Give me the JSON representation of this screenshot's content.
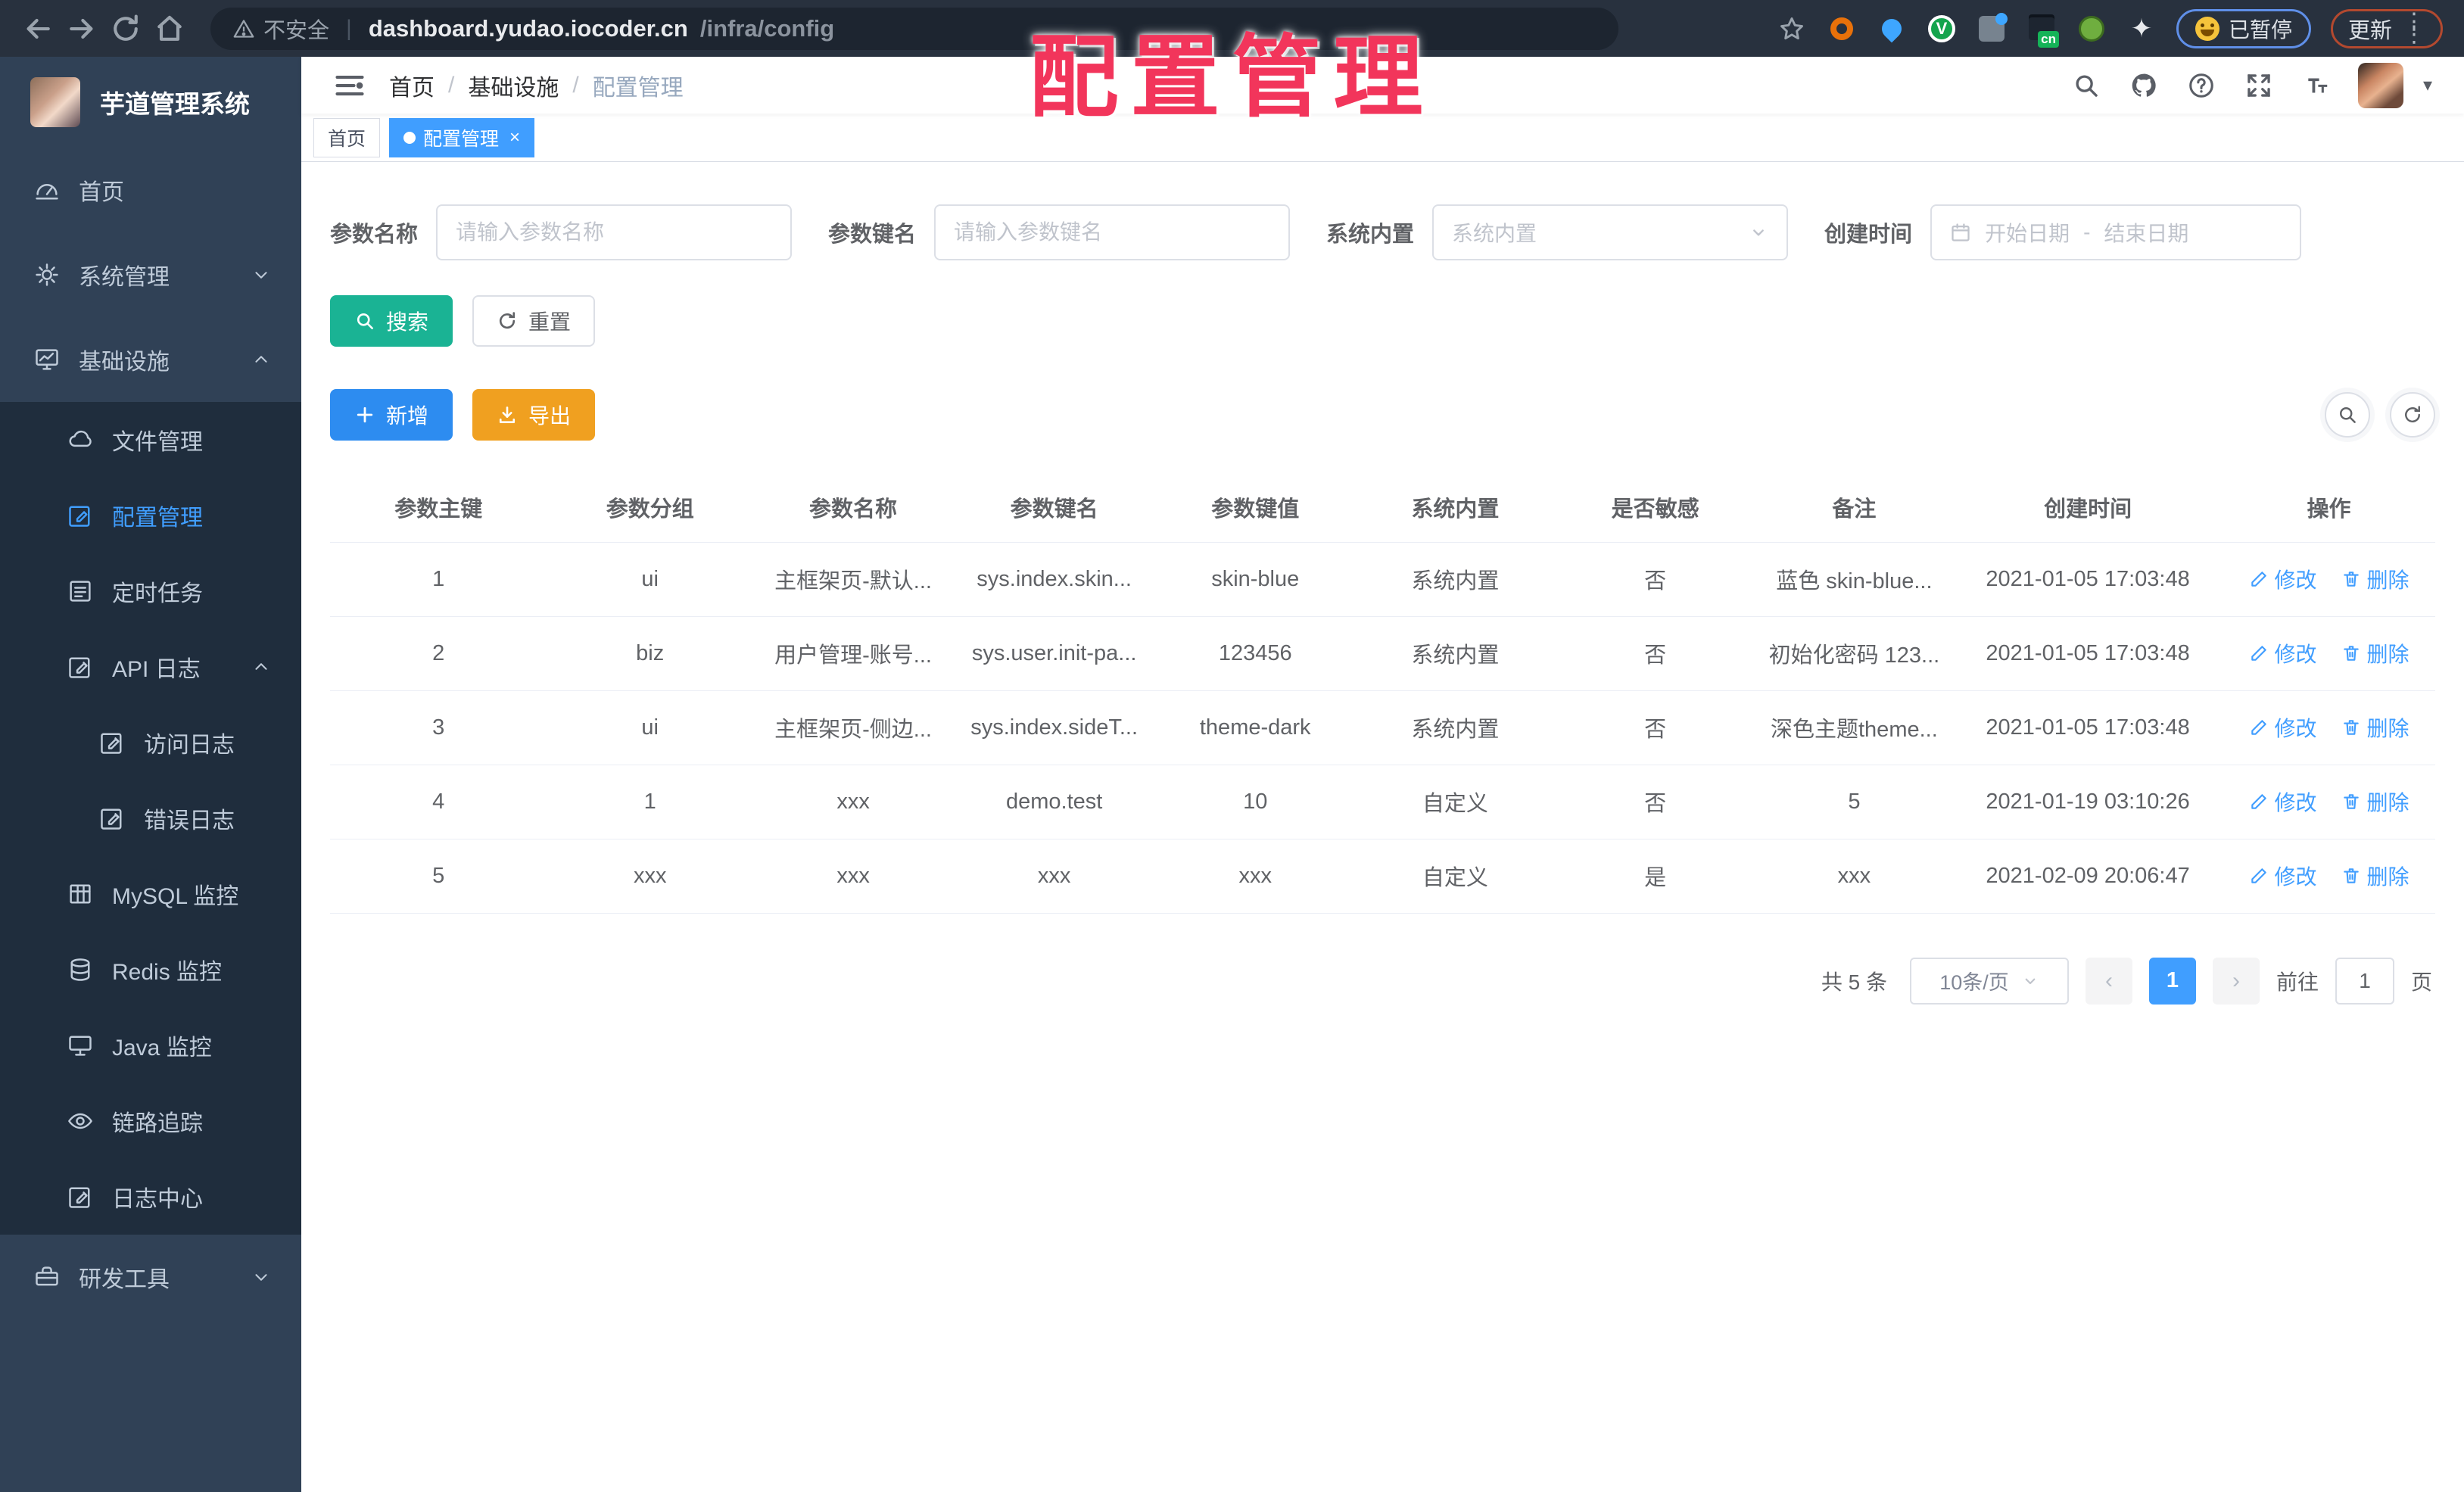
{
  "annotation": {
    "text": "配置管理"
  },
  "browser": {
    "security_label": "不安全",
    "url_host": "dashboard.yudao.iocoder.cn",
    "url_path": "/infra/config",
    "paused_label": "已暂停",
    "update_label": "更新"
  },
  "sidebar": {
    "title": "芋道管理系统",
    "items": [
      {
        "key": "home",
        "label": "首页",
        "icon": "dashboard-icon",
        "level": 1
      },
      {
        "key": "system-management",
        "label": "系统管理",
        "icon": "gear-icon",
        "level": 1,
        "chevron": "down"
      },
      {
        "key": "infrastructure",
        "label": "基础设施",
        "icon": "infra-icon",
        "level": 1,
        "chevron": "up"
      },
      {
        "key": "file-management",
        "label": "文件管理",
        "icon": "cloud-icon",
        "level": 2
      },
      {
        "key": "config-management",
        "label": "配置管理",
        "icon": "edit-square-icon",
        "level": 2,
        "active": true
      },
      {
        "key": "scheduled-tasks",
        "label": "定时任务",
        "icon": "task-icon",
        "level": 2
      },
      {
        "key": "api-logs",
        "label": "API 日志",
        "icon": "log-icon",
        "level": 2,
        "chevron": "up"
      },
      {
        "key": "access-logs",
        "label": "访问日志",
        "icon": "log-icon",
        "level": 3
      },
      {
        "key": "error-logs",
        "label": "错误日志",
        "icon": "log-icon",
        "level": 3
      },
      {
        "key": "mysql-monitor",
        "label": "MySQL 监控",
        "icon": "table-grid-icon",
        "level": 2
      },
      {
        "key": "redis-monitor",
        "label": "Redis 监控",
        "icon": "database-icon",
        "level": 2
      },
      {
        "key": "java-monitor",
        "label": "Java 监控",
        "icon": "monitor-icon",
        "level": 2
      },
      {
        "key": "tracing",
        "label": "链路追踪",
        "icon": "eye-icon",
        "level": 2
      },
      {
        "key": "log-center",
        "label": "日志中心",
        "icon": "log-icon",
        "level": 2
      },
      {
        "key": "dev-tools",
        "label": "研发工具",
        "icon": "toolbox-icon",
        "level": 1,
        "chevron": "down"
      }
    ]
  },
  "header": {
    "breadcrumb": {
      "0": "首页",
      "1": "基础设施",
      "2": "配置管理"
    }
  },
  "tabs": {
    "0": {
      "label": "首页"
    },
    "1": {
      "label": "配置管理"
    }
  },
  "filters": {
    "param_name_label": "参数名称",
    "param_name_placeholder": "请输入参数名称",
    "param_key_label": "参数键名",
    "param_key_placeholder": "请输入参数键名",
    "builtin_label": "系统内置",
    "builtin_placeholder": "系统内置",
    "create_time_label": "创建时间",
    "date_start_placeholder": "开始日期",
    "date_separator": "-",
    "date_end_placeholder": "结束日期",
    "search_label": "搜索",
    "reset_label": "重置",
    "add_label": "新增",
    "export_label": "导出"
  },
  "table": {
    "columns": [
      "参数主键",
      "参数分组",
      "参数名称",
      "参数键名",
      "参数键值",
      "系统内置",
      "是否敏感",
      "备注",
      "创建时间",
      "操作"
    ],
    "rows": [
      [
        "1",
        "ui",
        "主框架页-默认...",
        "sys.index.skin...",
        "skin-blue",
        "系统内置",
        "否",
        "蓝色 skin-blue...",
        "2021-01-05 17:03:48"
      ],
      [
        "2",
        "biz",
        "用户管理-账号...",
        "sys.user.init-pa...",
        "123456",
        "系统内置",
        "否",
        "初始化密码 123...",
        "2021-01-05 17:03:48"
      ],
      [
        "3",
        "ui",
        "主框架页-侧边...",
        "sys.index.sideT...",
        "theme-dark",
        "系统内置",
        "否",
        "深色主题theme...",
        "2021-01-05 17:03:48"
      ],
      [
        "4",
        "1",
        "xxx",
        "demo.test",
        "10",
        "自定义",
        "否",
        "5",
        "2021-01-19 03:10:26"
      ],
      [
        "5",
        "xxx",
        "xxx",
        "xxx",
        "xxx",
        "自定义",
        "是",
        "xxx",
        "2021-02-09 20:06:47"
      ]
    ],
    "action_edit": "修改",
    "action_delete": "删除"
  },
  "pagination": {
    "total_text": "共 5 条",
    "page_size_text": "10条/页",
    "prev_symbol": "‹",
    "next_symbol": "›",
    "current_page": "1",
    "goto_label": "前往",
    "goto_value": "1",
    "page_unit": "页"
  },
  "colors": {
    "accent": "#409eff",
    "success": "#1ab394",
    "warning": "#f0a020",
    "sidebar_bg": "#304156",
    "submenu_bg": "#1f2d3d",
    "annotation": "#f2355b"
  }
}
